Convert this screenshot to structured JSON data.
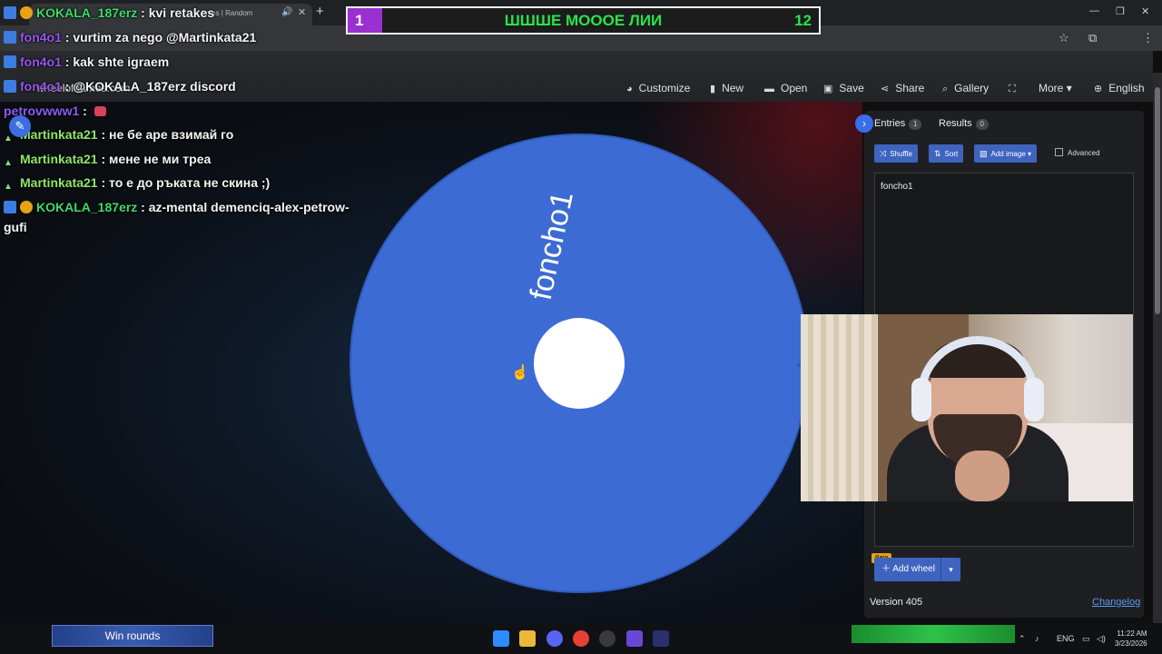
{
  "browser": {
    "tab_title": "ames | Random",
    "domain": "wheelofnames.com"
  },
  "overlay": {
    "counter_left": "1",
    "counter_title": "ШШШЕ МОООЕ ЛИИ",
    "counter_right": "12"
  },
  "chat": [
    {
      "user": "KOKALA_187erz",
      "msg": "kvi retakes",
      "color": "green"
    },
    {
      "user": "fon4o1",
      "msg": "vurtim za nego @Martinkata21",
      "color": "purple"
    },
    {
      "user": "fon4o1",
      "msg": "kak shte igraem",
      "color": "purple"
    },
    {
      "user": "fon4o1",
      "msg": "@KOKALA_187erz discord",
      "color": "purple"
    },
    {
      "user": "petrovwww1",
      "msg": "",
      "color": "purple2"
    },
    {
      "user": "Martinkata21",
      "msg": "не бе аре взимай го",
      "color": "light"
    },
    {
      "user": "Martinkata21",
      "msg": "мене не ми треа",
      "color": "light"
    },
    {
      "user": "Martinkata21",
      "msg": "то е до ръката не скина ;)",
      "color": "light"
    },
    {
      "user": "KOKALA_187erz",
      "msg": "az-mental demenciq-alex-petrow-",
      "color": "green",
      "cont": "gufi"
    }
  ],
  "menu": {
    "customize": "Customize",
    "new": "New",
    "open": "Open",
    "save": "Save",
    "share": "Share",
    "gallery": "Gallery",
    "more": "More",
    "language": "English"
  },
  "wheel": {
    "segment_label": "foncho1",
    "color": "#3d6bd4"
  },
  "panel": {
    "entries_label": "Entries",
    "entries_count": "1",
    "results_label": "Results",
    "results_count": "0",
    "shuffle": "Shuffle",
    "sort": "Sort",
    "add_image": "Add image",
    "advanced": "Advanced",
    "entry_text": "foncho1",
    "beta": "Beta",
    "add_wheel": "Add wheel",
    "version": "Version 405",
    "changelog": "Changelog"
  },
  "taskbar": {
    "widget": "Win rounds",
    "lang": "ENG",
    "time": "11:22 AM",
    "date": "3/23/2026"
  }
}
